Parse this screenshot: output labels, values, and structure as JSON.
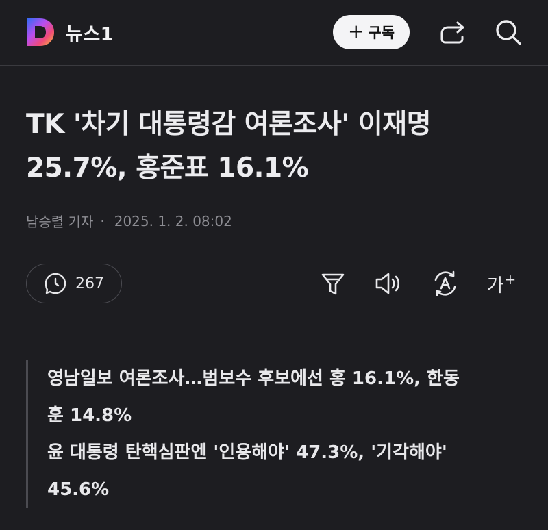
{
  "header": {
    "brand_name": "뉴스1",
    "subscribe_label": "구독",
    "subscribe_plus": "+",
    "icons": [
      "news1-logo-icon",
      "share-icon",
      "search-icon"
    ]
  },
  "article": {
    "headline_line1": "TK '차기 대통령감 여론조사' 이재명",
    "headline_line2": "25.7%, 홍준표 16.1%",
    "reporter": "남승렬 기자",
    "separator": "·",
    "date": "2025. 1. 2. 08:02",
    "comment_count": "267",
    "font_size_label": "가",
    "font_size_plus": "+",
    "summary_lines": [
      "영남일보 여론조사…범보수 후보에선 홍 16.1%, 한동",
      "훈 14.8%",
      "윤 대통령 탄핵심판엔 '인용해야' 47.3%, '기각해야'",
      "45.6%"
    ]
  },
  "colors": {
    "background": "#1d1d21",
    "text": "#ebebee",
    "muted": "#8d8d93",
    "logo_gradient": [
      "#2f6cf5",
      "#b84ef0",
      "#f04a79",
      "#f7c238"
    ]
  }
}
